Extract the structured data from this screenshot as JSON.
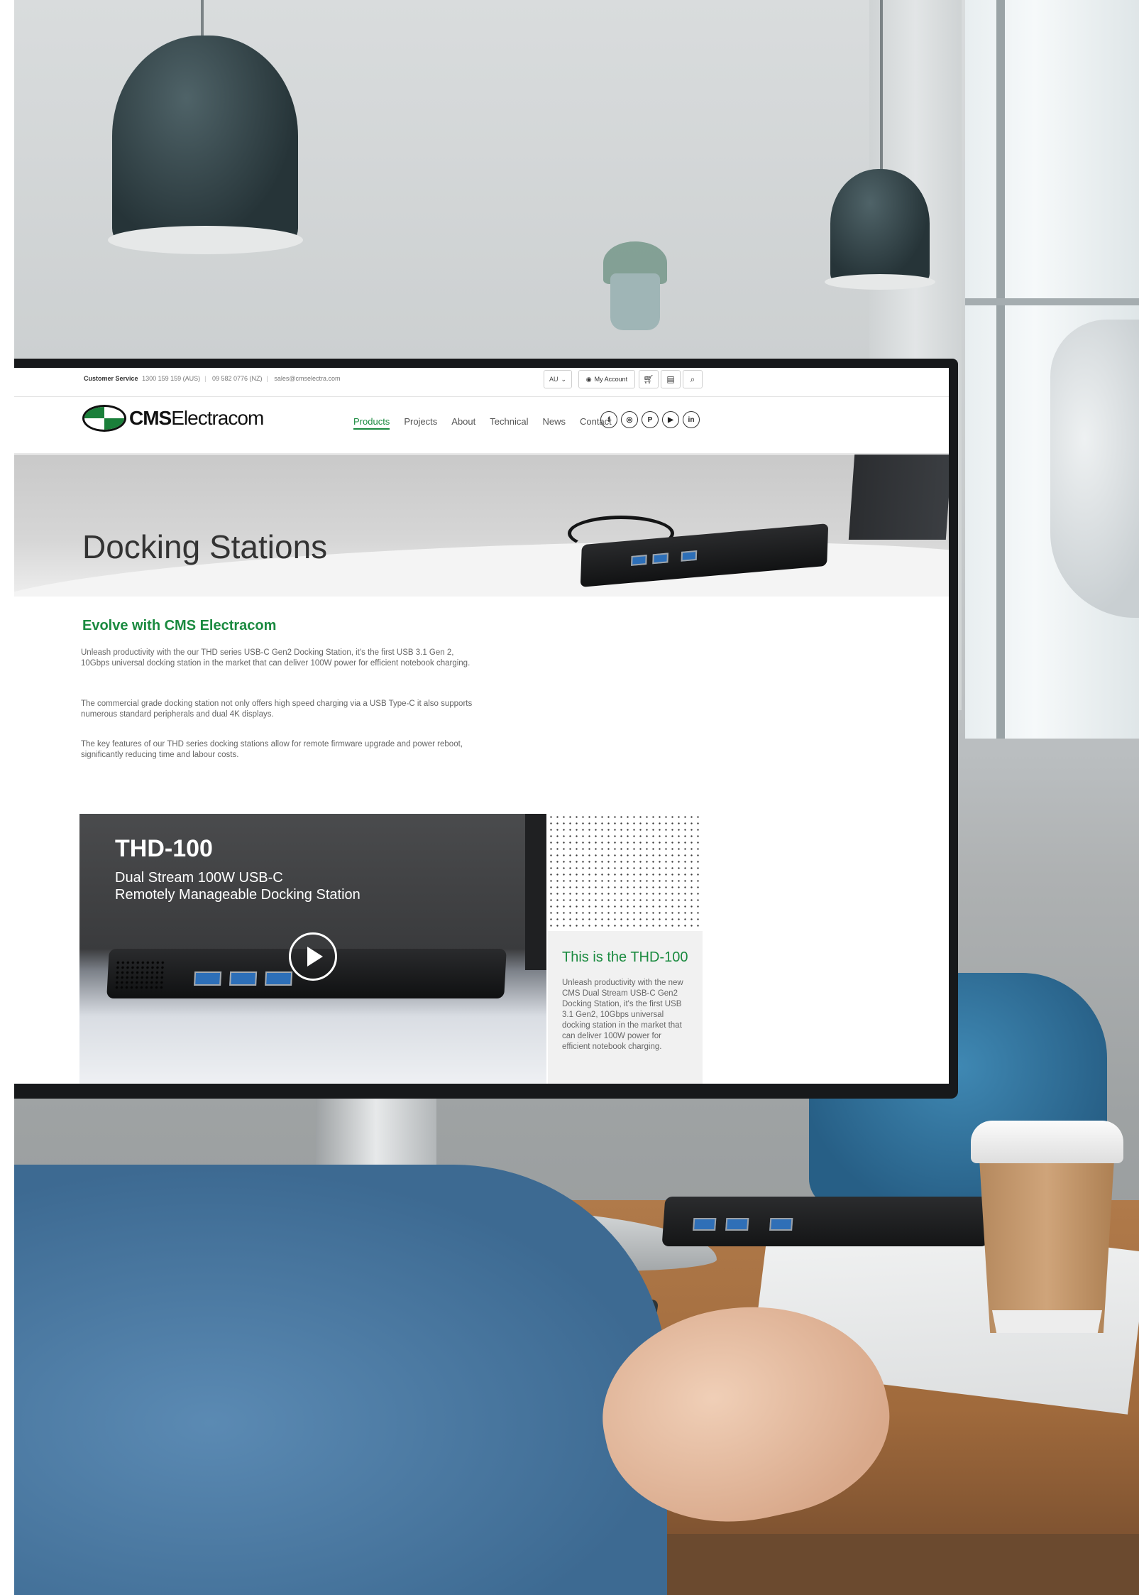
{
  "topbar": {
    "customer_service_label": "Customer Service",
    "phone_aus": "1300 159 159 (AUS)",
    "phone_nz": "09 582 0776 (NZ)",
    "email": "sales@cmselectra.com",
    "region": "AU",
    "account_label": "My Account",
    "icons": [
      "cart-icon",
      "clipboard-icon",
      "search-icon"
    ]
  },
  "brand": {
    "name_bold": "CMS",
    "name_rest": "Electracom",
    "primary_color": "#1a8a3f"
  },
  "nav": {
    "items": [
      "Products",
      "Projects",
      "About",
      "Technical",
      "News",
      "Contact"
    ],
    "active": "Products"
  },
  "socials": {
    "facebook": "f",
    "instagram": "◎",
    "pinterest": "P",
    "youtube": "▶",
    "linkedin": "in"
  },
  "hero": {
    "title": "Docking Stations"
  },
  "content": {
    "heading": "Evolve with CMS Electracom",
    "paragraphs": [
      "Unleash productivity with the our THD series USB-C Gen2 Docking Station, it's the first USB 3.1 Gen 2, 10Gbps universal docking station in the market that can deliver 100W power for efficient notebook charging.",
      "The commercial grade docking station not only offers high speed charging via a USB Type-C it also supports numerous standard peripherals and dual 4K displays.",
      "The key features of our THD series docking stations allow for remote firmware upgrade and power reboot, significantly reducing time and labour costs."
    ]
  },
  "video": {
    "title": "THD-100",
    "subtitle_line1": "Dual Stream 100W USB-C",
    "subtitle_line2": "Remotely Manageable Docking Station"
  },
  "side_card": {
    "title": "This is the THD-100",
    "text": "Unleash productivity with the new CMS Dual Stream USB-C Gen2 Docking Station, it's the first USB 3.1 Gen2, 10Gbps universal docking station in the market that can deliver 100W power for efficient notebook charging."
  }
}
